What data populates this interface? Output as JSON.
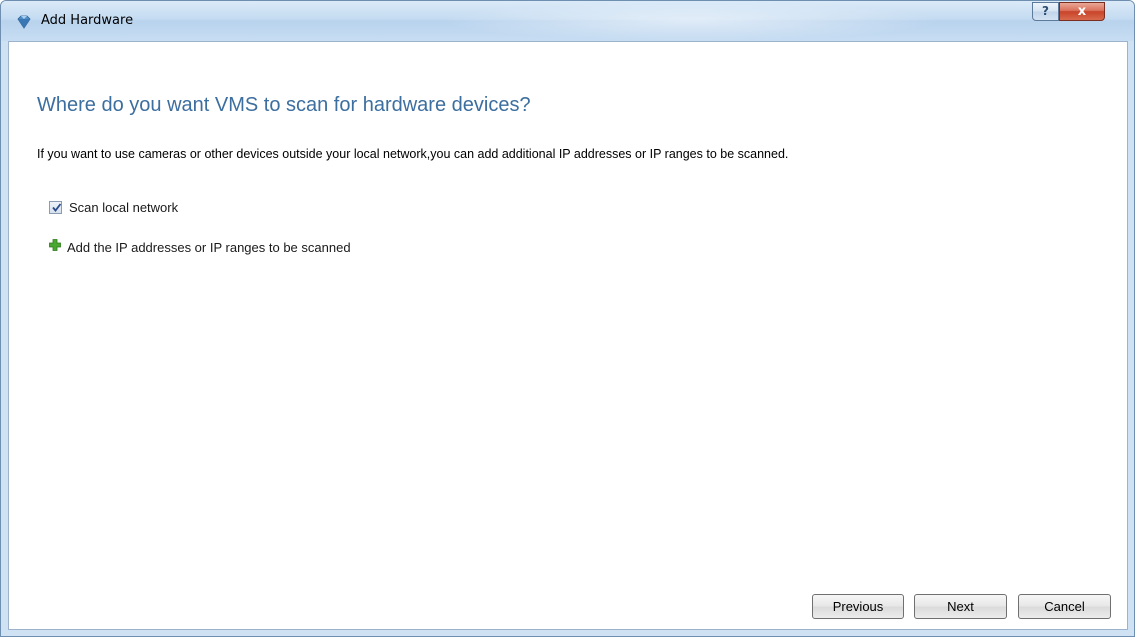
{
  "window": {
    "title": "Add Hardware",
    "help_label": "?",
    "close_label": "x"
  },
  "content": {
    "heading": "Where do you want VMS to scan for hardware devices?",
    "description": "If you want to use cameras or other devices outside your local network,you can add additional IP addresses or IP ranges to be scanned.",
    "scan_local": {
      "label": "Scan local network",
      "checked": true
    },
    "add_ip": {
      "label": "Add the IP addresses or IP ranges to be scanned"
    }
  },
  "buttons": {
    "previous": "Previous",
    "next": "Next",
    "cancel": "Cancel"
  },
  "icons": {
    "app": "gem-icon",
    "add": "plus-icon"
  },
  "colors": {
    "heading": "#3c6e9f",
    "add_icon": "#4aa82e",
    "titlebar": "#c4dbf1"
  }
}
